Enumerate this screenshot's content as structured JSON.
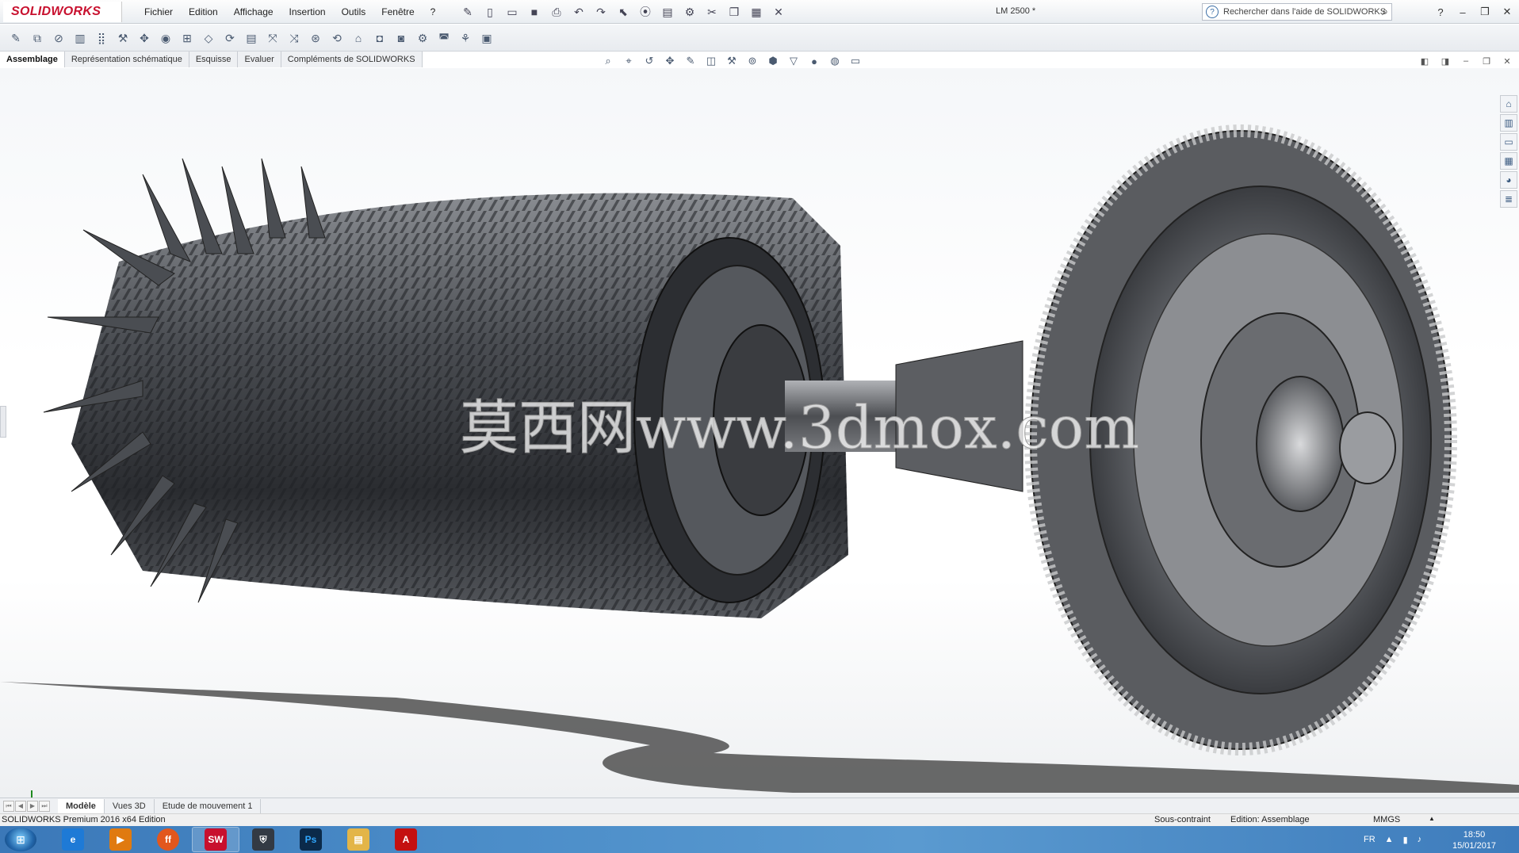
{
  "app": {
    "logo_text": "SOLIDWORKS",
    "document_title": "LM 2500 *"
  },
  "menu": [
    "Fichier",
    "Edition",
    "Affichage",
    "Insertion",
    "Outils",
    "Fenêtre",
    "?"
  ],
  "search": {
    "placeholder": "Rechercher dans l'aide de SOLIDWORKS"
  },
  "command_tabs": [
    {
      "label": "Assemblage",
      "active": true
    },
    {
      "label": "Représentation schématique",
      "active": false
    },
    {
      "label": "Esquisse",
      "active": false
    },
    {
      "label": "Evaluer",
      "active": false
    },
    {
      "label": "Compléments de SOLIDWORKS",
      "active": false
    }
  ],
  "watermark": "莫西网www.3dmox.com",
  "model_tabs": [
    {
      "label": "Modèle",
      "active": true
    },
    {
      "label": "Vues 3D",
      "active": false
    },
    {
      "label": "Etude de mouvement 1",
      "active": false
    }
  ],
  "status": {
    "edition": "SOLIDWORKS Premium 2016 x64 Edition",
    "constraint": "Sous-contraint",
    "mode": "Edition: Assemblage",
    "units": "MMGS",
    "units_arrow": "▲"
  },
  "taskbar": {
    "apps": [
      {
        "name": "ie",
        "label": "e",
        "color": "#1e7ad6"
      },
      {
        "name": "media",
        "label": "▶",
        "color": "#e07a10"
      },
      {
        "name": "firefox",
        "label": "ff",
        "color": "#e2571e"
      },
      {
        "name": "solidworks",
        "label": "SW",
        "color": "#c8102e"
      },
      {
        "name": "game",
        "label": "⛨",
        "color": "#333a44"
      },
      {
        "name": "photoshop",
        "label": "Ps",
        "color": "#0b2a4a"
      },
      {
        "name": "explorer",
        "label": "▤",
        "color": "#e3b548"
      },
      {
        "name": "acrobat",
        "label": "A",
        "color": "#c41010"
      }
    ],
    "lang": "FR",
    "time": "18:50",
    "date": "15/01/2017"
  },
  "colors": {
    "accent": "#c8102e",
    "taskbar": "#3b78b8"
  }
}
